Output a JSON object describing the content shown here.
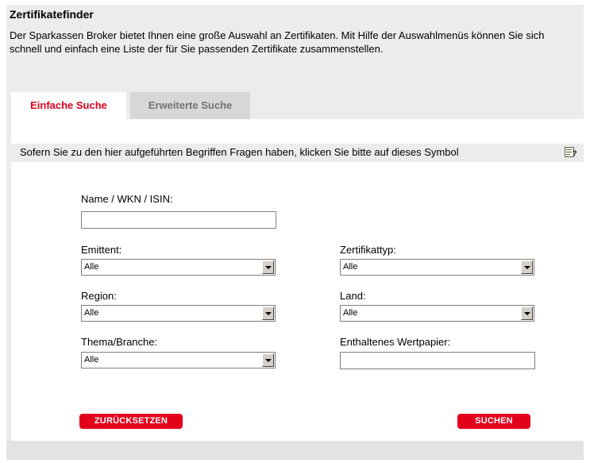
{
  "header": {
    "title": "Zertifikatefinder",
    "intro": "Der Sparkassen Broker bietet Ihnen eine große Auswahl an Zertifikaten. Mit Hilfe der Auswahlmenüs können Sie sich schnell und einfach eine Liste der für Sie passenden Zertifikate zusammenstellen."
  },
  "tabs": {
    "simple": "Einfache Suche",
    "advanced": "Erweiterte Suche"
  },
  "info": {
    "text": "Sofern Sie zu den hier aufgeführten Begriffen Fragen haben, klicken Sie bitte auf dieses Symbol"
  },
  "form": {
    "name": {
      "label": "Name / WKN / ISIN:",
      "value": ""
    },
    "emittent": {
      "label": "Emittent:",
      "value": "Alle"
    },
    "zertifikattyp": {
      "label": "Zertifikattyp:",
      "value": "Alle"
    },
    "region": {
      "label": "Region:",
      "value": "Alle"
    },
    "land": {
      "label": "Land:",
      "value": "Alle"
    },
    "thema": {
      "label": "Thema/Branche:",
      "value": "Alle"
    },
    "wertpapier": {
      "label": "Enthaltenes Wertpapier:",
      "value": ""
    }
  },
  "buttons": {
    "reset": "ZURÜCKSETZEN",
    "search": "SUCHEN"
  },
  "colors": {
    "accent": "#e3001b",
    "background": "#ececec",
    "inactive_tab": "#d7d7d7"
  }
}
